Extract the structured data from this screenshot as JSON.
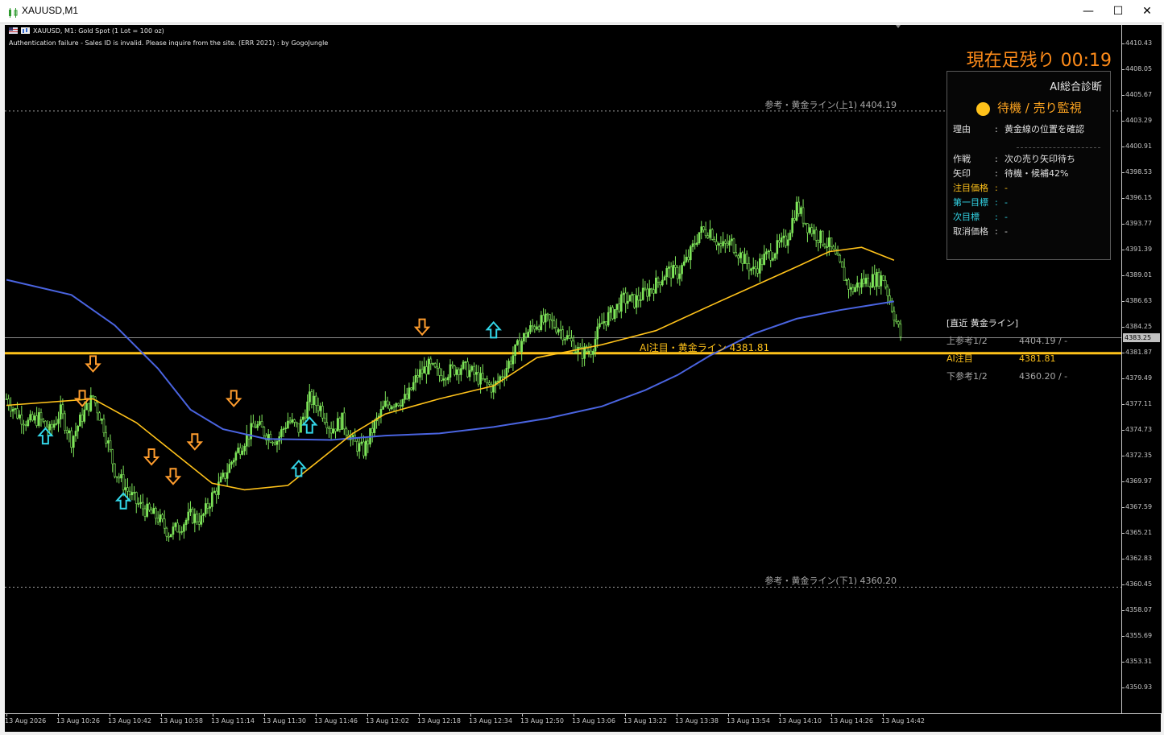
{
  "window": {
    "title": "XAUUSD,M1",
    "controls": [
      "—",
      "☐",
      "✕"
    ]
  },
  "chart_info": {
    "symbol_line": "XAUUSD, M1:  Gold Spot (1 Lot = 100 oz)",
    "error_line": "Authentication failure - Sales ID is invalid. Please inquire from the site. (ERR 2021) : by GogoJungle"
  },
  "timer": "現在足残り 00:19",
  "ai_panel": {
    "title": "AI総合診断",
    "status": "待機 / 売り監視",
    "status_color": "#ffc21a",
    "rows_top": [
      {
        "key": "理由",
        "sep": ":",
        "value": "黄金線の位置を確認",
        "color": "#e0e0e0"
      }
    ],
    "rows": [
      {
        "key": "作戦",
        "sep": ":",
        "value": "次の売り矢印待ち",
        "color": "#e0e0e0"
      },
      {
        "key": "矢印",
        "sep": ":",
        "value": "待機・候補42%",
        "color": "#e0e0e0"
      },
      {
        "key": "注目価格",
        "sep": ":",
        "value": "-",
        "color": "#ffc21a"
      },
      {
        "key": "第一目標",
        "sep": ":",
        "value": "-",
        "color": "#33d6e8"
      },
      {
        "key": "次目標",
        "sep": ":",
        "value": "-",
        "color": "#33d6e8"
      },
      {
        "key": "取消価格",
        "sep": ":",
        "value": "-",
        "color": "#d8d8d8"
      }
    ]
  },
  "recent_gold": {
    "title": "[直近 黄金ライン]",
    "rows": [
      {
        "key": "上参考1/2",
        "value": "4404.19 / -",
        "color": "#a8a8a8"
      },
      {
        "key": "AI注目",
        "value": "4381.81",
        "color": "#ffc21a"
      },
      {
        "key": "下参考1/2",
        "value": "4360.20 / -",
        "color": "#a8a8a8"
      }
    ]
  },
  "lines": {
    "upper_ref_label": "参考・黄金ライン(上1) 4404.19",
    "ai_line_label": "AI注目・黄金ライン 4381.81",
    "lower_ref_label": "参考・黄金ライン(下1) 4360.20",
    "gold_color": "#ffc21a"
  },
  "price_axis": {
    "labels": [
      "4410.43",
      "4408.05",
      "4405.67",
      "4403.29",
      "4400.91",
      "4398.53",
      "4396.15",
      "4393.77",
      "4391.39",
      "4389.01",
      "4386.63",
      "4384.25",
      "4381.87",
      "4379.49",
      "4377.11",
      "4374.73",
      "4372.35",
      "4369.97",
      "4367.59",
      "4365.21",
      "4362.83",
      "4360.45",
      "4358.07",
      "4355.69",
      "4353.31",
      "4350.93"
    ],
    "current_price": "4383.25"
  },
  "time_axis": {
    "labels": [
      "13 Aug 2026",
      "13 Aug 10:26",
      "13 Aug 10:42",
      "13 Aug 10:58",
      "13 Aug 11:14",
      "13 Aug 11:30",
      "13 Aug 11:46",
      "13 Aug 12:02",
      "13 Aug 12:18",
      "13 Aug 12:34",
      "13 Aug 12:50",
      "13 Aug 13:06",
      "13 Aug 13:22",
      "13 Aug 13:38",
      "13 Aug 13:54",
      "13 Aug 14:10",
      "13 Aug 14:26",
      "13 Aug 14:42"
    ]
  },
  "chart_data": {
    "type": "candlestick",
    "symbol": "XAUUSD",
    "timeframe": "M1",
    "close_path": [
      [
        0,
        4377.6
      ],
      [
        5,
        4376.2
      ],
      [
        10,
        4375.4
      ],
      [
        15,
        4375.8
      ],
      [
        20,
        4374.6
      ],
      [
        25,
        4376.4
      ],
      [
        30,
        4373.8
      ],
      [
        35,
        4376.0
      ],
      [
        40,
        4377.8
      ],
      [
        45,
        4375.0
      ],
      [
        50,
        4371.0
      ],
      [
        55,
        4369.4
      ],
      [
        60,
        4368.0
      ],
      [
        65,
        4367.2
      ],
      [
        70,
        4366.6
      ],
      [
        75,
        4365.2
      ],
      [
        80,
        4365.8
      ],
      [
        85,
        4366.8
      ],
      [
        90,
        4366.4
      ],
      [
        95,
        4368.6
      ],
      [
        100,
        4370.2
      ],
      [
        105,
        4372.2
      ],
      [
        110,
        4373.8
      ],
      [
        115,
        4375.2
      ],
      [
        120,
        4374.4
      ],
      [
        125,
        4373.8
      ],
      [
        130,
        4375.6
      ],
      [
        135,
        4374.8
      ],
      [
        140,
        4377.6
      ],
      [
        145,
        4376.8
      ],
      [
        150,
        4374.8
      ],
      [
        155,
        4375.6
      ],
      [
        160,
        4373.6
      ],
      [
        165,
        4372.8
      ],
      [
        170,
        4375.2
      ],
      [
        175,
        4377.0
      ],
      [
        180,
        4377.4
      ],
      [
        185,
        4377.6
      ],
      [
        190,
        4379.8
      ],
      [
        195,
        4380.6
      ],
      [
        200,
        4379.8
      ],
      [
        205,
        4380.2
      ],
      [
        210,
        4380.6
      ],
      [
        215,
        4380.0
      ],
      [
        220,
        4379.2
      ],
      [
        225,
        4378.6
      ],
      [
        230,
        4380.2
      ],
      [
        235,
        4382.0
      ],
      [
        240,
        4383.6
      ],
      [
        245,
        4384.6
      ],
      [
        250,
        4384.8
      ],
      [
        255,
        4384.2
      ],
      [
        260,
        4383.0
      ],
      [
        265,
        4381.8
      ],
      [
        270,
        4382.2
      ],
      [
        275,
        4384.6
      ],
      [
        280,
        4385.6
      ],
      [
        285,
        4386.8
      ],
      [
        290,
        4386.6
      ],
      [
        295,
        4387.4
      ],
      [
        300,
        4388.2
      ],
      [
        305,
        4389.4
      ],
      [
        310,
        4389.2
      ],
      [
        315,
        4390.6
      ],
      [
        320,
        4393.0
      ],
      [
        325,
        4393.2
      ],
      [
        330,
        4391.6
      ],
      [
        335,
        4392.0
      ],
      [
        340,
        4390.6
      ],
      [
        345,
        4389.4
      ],
      [
        350,
        4390.6
      ],
      [
        355,
        4391.4
      ],
      [
        360,
        4392.2
      ],
      [
        365,
        4395.4
      ],
      [
        370,
        4393.6
      ],
      [
        375,
        4392.6
      ],
      [
        380,
        4391.8
      ],
      [
        385,
        4389.8
      ],
      [
        390,
        4387.6
      ],
      [
        395,
        4388.4
      ],
      [
        400,
        4388.6
      ],
      [
        405,
        4388.8
      ],
      [
        410,
        4385.4
      ],
      [
        413,
        4383.4
      ]
    ],
    "ma_yellow": [
      [
        0,
        4377.0
      ],
      [
        40,
        4377.6
      ],
      [
        60,
        4375.4
      ],
      [
        80,
        4372.2
      ],
      [
        95,
        4369.8
      ],
      [
        110,
        4369.2
      ],
      [
        130,
        4369.6
      ],
      [
        145,
        4372.0
      ],
      [
        160,
        4374.4
      ],
      [
        175,
        4376.2
      ],
      [
        200,
        4377.6
      ],
      [
        225,
        4378.8
      ],
      [
        245,
        4381.4
      ],
      [
        260,
        4382.0
      ],
      [
        275,
        4382.6
      ],
      [
        300,
        4383.9
      ],
      [
        325,
        4386.2
      ],
      [
        345,
        4388.0
      ],
      [
        365,
        4389.8
      ],
      [
        380,
        4391.2
      ],
      [
        395,
        4391.6
      ],
      [
        410,
        4390.4
      ]
    ],
    "ma_blue": [
      [
        0,
        4388.6
      ],
      [
        30,
        4387.2
      ],
      [
        50,
        4384.4
      ],
      [
        70,
        4380.4
      ],
      [
        85,
        4376.6
      ],
      [
        100,
        4374.8
      ],
      [
        120,
        4373.9
      ],
      [
        150,
        4373.8
      ],
      [
        175,
        4374.2
      ],
      [
        200,
        4374.4
      ],
      [
        225,
        4375.0
      ],
      [
        250,
        4375.8
      ],
      [
        275,
        4376.9
      ],
      [
        295,
        4378.4
      ],
      [
        310,
        4379.8
      ],
      [
        325,
        4381.6
      ],
      [
        345,
        4383.6
      ],
      [
        365,
        4385.0
      ],
      [
        385,
        4385.8
      ],
      [
        410,
        4386.6
      ]
    ],
    "sell_arrows": [
      [
        40,
        4380.8
      ],
      [
        35,
        4377.6
      ],
      [
        67,
        4372.2
      ],
      [
        77,
        4370.4
      ],
      [
        87,
        4373.6
      ],
      [
        105,
        4377.6
      ],
      [
        192,
        4384.2
      ]
    ],
    "buy_arrows": [
      [
        18,
        4374.2
      ],
      [
        54,
        4368.2
      ],
      [
        135,
        4371.2
      ],
      [
        140,
        4375.2
      ],
      [
        225,
        4384.0
      ]
    ],
    "levels": {
      "upper_ref": 4404.19,
      "ai_focus": 4381.81,
      "lower_ref": 4360.2,
      "current": 4383.25
    },
    "ylim": [
      4350.0,
      4412.0
    ],
    "xlim": [
      0,
      413
    ],
    "colors": {
      "candle": "#7fe65a",
      "ma_yellow": "#ffc21a",
      "ma_blue": "#4a64e0",
      "sell_arrow": "#ff9d2e",
      "buy_arrow": "#33d6e8"
    }
  }
}
